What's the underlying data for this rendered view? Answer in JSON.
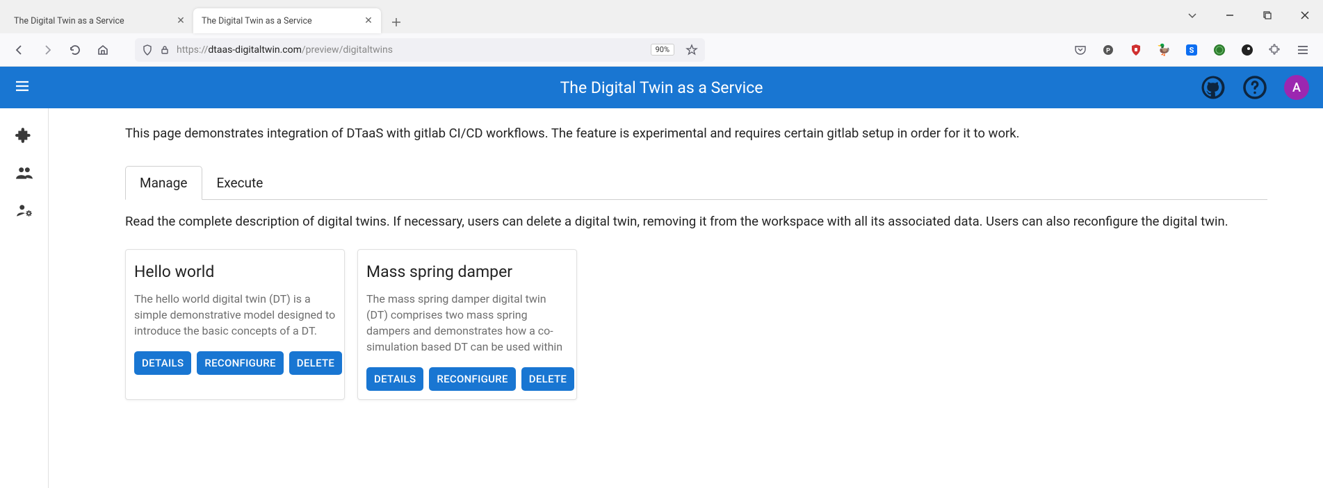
{
  "browser": {
    "tabs": [
      {
        "title": "The Digital Twin as a Service",
        "active": false
      },
      {
        "title": "The Digital Twin as a Service",
        "active": true
      }
    ],
    "url_prefix": "https://",
    "url_host": "dtaas-digitaltwin.com",
    "url_path": "/preview/digitaltwins",
    "zoom": "90%"
  },
  "header": {
    "title": "The Digital Twin as a Service",
    "avatar_letter": "A"
  },
  "main": {
    "intro": "This page demonstrates integration of DTaaS with gitlab CI/CD workflows. The feature is experimental and requires certain gitlab setup in order for it to work.",
    "tabs": [
      {
        "label": "Manage",
        "active": true
      },
      {
        "label": "Execute",
        "active": false
      }
    ],
    "manage_blurb": "Read the complete description of digital twins. If necessary, users can delete a digital twin, removing it from the workspace with all its associated data. Users can also reconfigure the digital twin.",
    "card_labels": {
      "details": "DETAILS",
      "reconfigure": "RECONFIGURE",
      "delete": "DELETE"
    },
    "cards": [
      {
        "title": "Hello world",
        "desc": "The hello world digital twin (DT) is a simple demonstrative model designed to introduce the basic concepts of a DT."
      },
      {
        "title": "Mass spring damper",
        "desc": "The mass spring damper digital twin (DT) comprises two mass spring dampers and demonstrates how a co-simulation based DT can be used within"
      }
    ]
  }
}
